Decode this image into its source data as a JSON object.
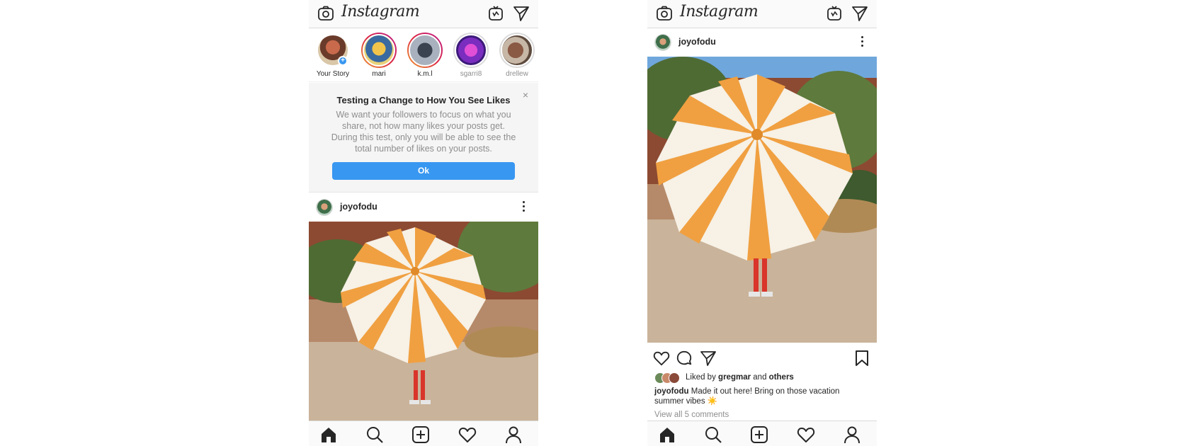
{
  "app": {
    "logo_text": "Instagram"
  },
  "left_screen": {
    "stories": [
      {
        "name": "Your Story",
        "state": "own"
      },
      {
        "name": "mari",
        "state": "unseen"
      },
      {
        "name": "k.m.l",
        "state": "unseen"
      },
      {
        "name": "sgarri8",
        "state": "seen"
      },
      {
        "name": "drellew",
        "state": "seen"
      }
    ],
    "notice": {
      "title": "Testing a Change to How You See Likes",
      "body": "We want your followers to focus on what you share, not how many likes your posts get. During this test, only you will be able to see the total number of likes on your posts.",
      "close_glyph": "×",
      "ok_label": "Ok"
    },
    "post": {
      "username": "joyofodu"
    }
  },
  "right_screen": {
    "post": {
      "username": "joyofodu",
      "liked_by_prefix": "Liked by",
      "liked_by_user": "gregmar",
      "liked_by_and": "and",
      "liked_by_others": "others",
      "caption_user": "joyofodu",
      "caption_text": "Made it out here! Bring on those vacation summer vibes ☀️",
      "view_comments": "View all 5 comments"
    }
  },
  "icons": {
    "top_bar": [
      "camera-icon",
      "igtv-icon",
      "direct-message-icon"
    ],
    "post_actions": [
      "heart-icon",
      "comment-icon",
      "share-icon",
      "bookmark-icon"
    ],
    "bottom_nav": [
      "home-icon",
      "search-icon",
      "new-post-icon",
      "activity-heart-icon",
      "profile-icon"
    ]
  },
  "colors": {
    "accent": "#3897f0",
    "text": "#262626",
    "muted": "#8e8e8e",
    "story_ring": "#dc2743"
  }
}
